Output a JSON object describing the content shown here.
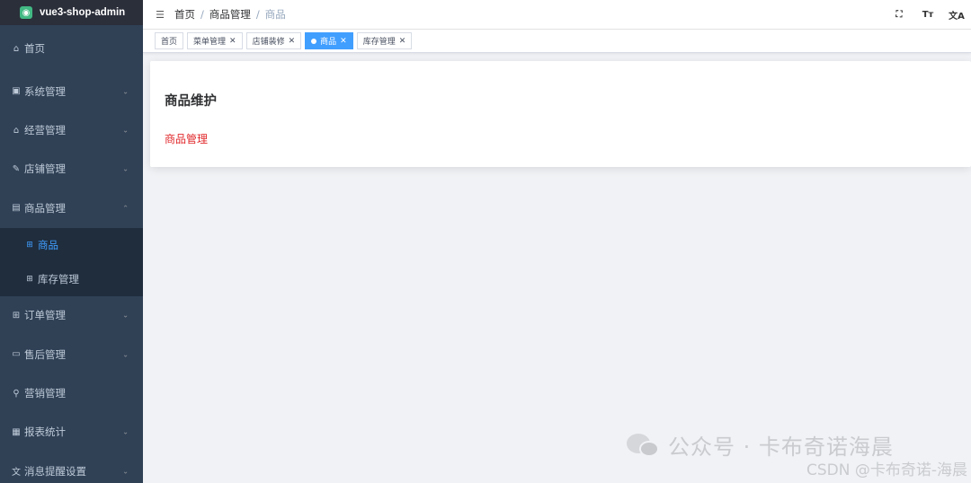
{
  "app": {
    "title": "vue3-shop-admin",
    "logo_glyph": "◉"
  },
  "sidebar": {
    "items": [
      {
        "label": "首页",
        "icon": "home-icon",
        "glyph": "⌂",
        "expandable": false
      },
      {
        "label": "系统管理",
        "icon": "monitor-icon",
        "glyph": "▣",
        "expandable": true
      },
      {
        "label": "经营管理",
        "icon": "home-icon",
        "glyph": "⌂",
        "expandable": true
      },
      {
        "label": "店铺管理",
        "icon": "edit-icon",
        "glyph": "✎",
        "expandable": true
      },
      {
        "label": "商品管理",
        "icon": "document-icon",
        "glyph": "▤",
        "expandable": true,
        "open": true
      },
      {
        "label": "订单管理",
        "icon": "grid-icon",
        "glyph": "⊞",
        "expandable": true
      },
      {
        "label": "售后管理",
        "icon": "screen-icon",
        "glyph": "▭",
        "expandable": true
      },
      {
        "label": "营销管理",
        "icon": "link-icon",
        "glyph": "⚲",
        "expandable": false
      },
      {
        "label": "报表统计",
        "icon": "table-icon",
        "glyph": "▦",
        "expandable": true
      },
      {
        "label": "消息提醒设置",
        "icon": "translate-icon",
        "glyph": "文",
        "expandable": true
      }
    ],
    "sub_items": [
      {
        "label": "商品",
        "icon": "grid-icon",
        "glyph": "⊞",
        "active": true
      },
      {
        "label": "库存管理",
        "icon": "grid-icon",
        "glyph": "⊞",
        "active": false
      }
    ],
    "arrow_down": "⌄",
    "arrow_up": "⌃"
  },
  "header": {
    "hamburger_glyph": "☰",
    "breadcrumb": [
      "首页",
      "商品管理",
      "商品"
    ],
    "separator": "/",
    "tools": [
      {
        "name": "fullscreen-icon",
        "glyph": "⛶"
      },
      {
        "name": "font-size-icon",
        "glyph": "Tт"
      },
      {
        "name": "language-icon",
        "glyph": "文A"
      }
    ]
  },
  "tags": [
    {
      "label": "首页",
      "closable": false,
      "active": false
    },
    {
      "label": "菜单管理",
      "closable": true,
      "active": false
    },
    {
      "label": "店铺装修",
      "closable": true,
      "active": false
    },
    {
      "label": "商品",
      "closable": true,
      "active": true
    },
    {
      "label": "库存管理",
      "closable": true,
      "active": false
    }
  ],
  "tag_close_glyph": "✕",
  "main": {
    "title": "商品维护",
    "subtitle": "商品管理"
  },
  "watermark": {
    "text": "公众号 · 卡布奇诺海晨",
    "csdn": "CSDN @卡布奇诺-海晨"
  },
  "colors": {
    "sidebar_bg": "#304156",
    "accent": "#409eff",
    "subtitle_red": "#e1272a"
  }
}
